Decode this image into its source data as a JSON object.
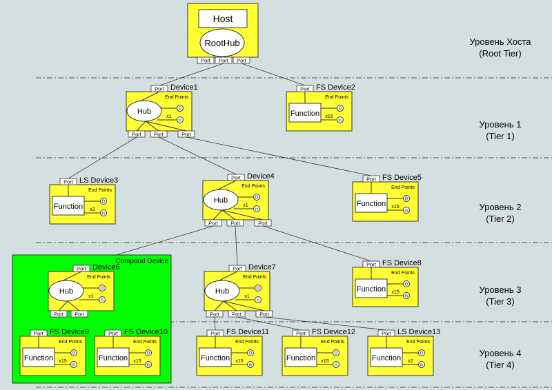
{
  "colors": {
    "background": "#d4e0e0",
    "device": "#ffff33",
    "compound": "#00ff00",
    "box": "#ffffff"
  },
  "labels": {
    "port": "Port",
    "end_points": "End Points",
    "hub": "Hub",
    "function": "Function",
    "ep0": "0",
    "epn": "n",
    "host": "Host",
    "roothub": "RootHub",
    "compound": "Compoud Device"
  },
  "tiers": [
    {
      "name": "Уровень Хоста",
      "sub": "(Root Tier)"
    },
    {
      "name": "Уровень 1",
      "sub": "(Tier 1)"
    },
    {
      "name": "Уровень 2",
      "sub": "(Tier 2)"
    },
    {
      "name": "Уровень 3",
      "sub": "(Tier 3)"
    },
    {
      "name": "Уровень 4",
      "sub": "(Tier 4)"
    }
  ],
  "devices": [
    {
      "id": "d1",
      "title": "Device1",
      "kind": "hub",
      "mult": "x1"
    },
    {
      "id": "d2",
      "title": "FS  Device2",
      "kind": "function",
      "mult": "x15"
    },
    {
      "id": "d3",
      "title": "LS  Device3",
      "kind": "function",
      "mult": "x2"
    },
    {
      "id": "d4",
      "title": "Device4",
      "kind": "hub",
      "mult": "x1"
    },
    {
      "id": "d5",
      "title": "FS  Device5",
      "kind": "function",
      "mult": "x15"
    },
    {
      "id": "d6",
      "title": "Device6",
      "kind": "hub",
      "mult": "x1"
    },
    {
      "id": "d7",
      "title": "Device7",
      "kind": "hub",
      "mult": "x1"
    },
    {
      "id": "d8",
      "title": "FS  Device8",
      "kind": "function",
      "mult": "x15"
    },
    {
      "id": "d9",
      "title": "FS  Device9",
      "kind": "function",
      "mult": "x15"
    },
    {
      "id": "d10",
      "title": "FS  Device10",
      "kind": "function",
      "mult": "x15"
    },
    {
      "id": "d11",
      "title": "FS  Device11",
      "kind": "function",
      "mult": "x15"
    },
    {
      "id": "d12",
      "title": "FS  Device12",
      "kind": "function",
      "mult": "x15"
    },
    {
      "id": "d13",
      "title": "LS  Device13",
      "kind": "function",
      "mult": "x2"
    }
  ],
  "links": [
    [
      "root",
      "d1"
    ],
    [
      "root",
      "d2"
    ],
    [
      "d1",
      "d3"
    ],
    [
      "d1",
      "d4"
    ],
    [
      "d1",
      "d5"
    ],
    [
      "d4",
      "d6"
    ],
    [
      "d4",
      "d7"
    ],
    [
      "d4",
      "d8"
    ],
    [
      "d6",
      "d9"
    ],
    [
      "d6",
      "d10"
    ],
    [
      "d7",
      "d11"
    ],
    [
      "d7",
      "d12"
    ],
    [
      "d7",
      "d13"
    ]
  ]
}
